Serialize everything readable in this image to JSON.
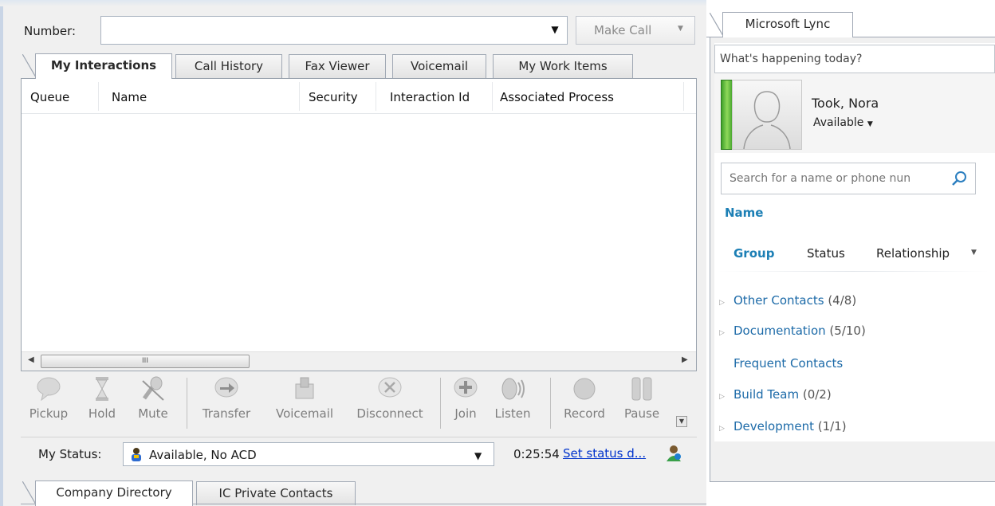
{
  "call_bar": {
    "number_label": "Number:",
    "number_value": "",
    "make_call_label": "Make Call"
  },
  "tabs": [
    {
      "label": "My Interactions",
      "active": true
    },
    {
      "label": "Call History",
      "active": false
    },
    {
      "label": "Fax Viewer",
      "active": false
    },
    {
      "label": "Voicemail",
      "active": false
    },
    {
      "label": "My Work Items",
      "active": false
    }
  ],
  "grid": {
    "columns": [
      "Queue",
      "Name",
      "Security",
      "Interaction Id",
      "Associated Process"
    ],
    "rows": [],
    "scroll_thumb_glyph": "III"
  },
  "toolbar": [
    {
      "label": "Pickup",
      "icon": "speech-bubble-icon"
    },
    {
      "label": "Hold",
      "icon": "hourglass-icon"
    },
    {
      "label": "Mute",
      "icon": "microphone-muted-icon"
    },
    {
      "label": "Transfer",
      "icon": "transfer-arrow-icon"
    },
    {
      "label": "Voicemail",
      "icon": "voicemail-icon"
    },
    {
      "label": "Disconnect",
      "icon": "disconnect-x-icon"
    },
    {
      "label": "Join",
      "icon": "join-plus-icon"
    },
    {
      "label": "Listen",
      "icon": "listen-speaker-icon"
    },
    {
      "label": "Record",
      "icon": "record-dot-icon"
    },
    {
      "label": "Pause",
      "icon": "pause-icon"
    }
  ],
  "status_bar": {
    "label": "My Status:",
    "value": "Available, No ACD",
    "time": "0:25:54",
    "link": "Set status d..."
  },
  "bottom_tabs": [
    {
      "label": "Company Directory",
      "active": true
    },
    {
      "label": "IC Private Contacts",
      "active": false
    }
  ],
  "lync": {
    "tab_label": "Microsoft Lync",
    "whats_happening": "What's happening today?",
    "user_name": "Took, Nora",
    "availability": "Available",
    "search_placeholder": "Search for a name or phone nun",
    "name_header": "Name",
    "filters": {
      "group": "Group",
      "status": "Status",
      "relationship": "Relationship"
    },
    "groups": [
      {
        "name": "Other Contacts",
        "count": "(4/8)",
        "expandable": true
      },
      {
        "name": "Documentation",
        "count": "(5/10)",
        "expandable": true
      },
      {
        "name": "Frequent Contacts",
        "count": "",
        "expandable": false
      },
      {
        "name": "Build Team",
        "count": "(0/2)",
        "expandable": true
      },
      {
        "name": "Development",
        "count": "(1/1)",
        "expandable": true
      }
    ],
    "colors": {
      "accent": "#1c7fb5",
      "presence_green": "#3fa02a"
    }
  }
}
